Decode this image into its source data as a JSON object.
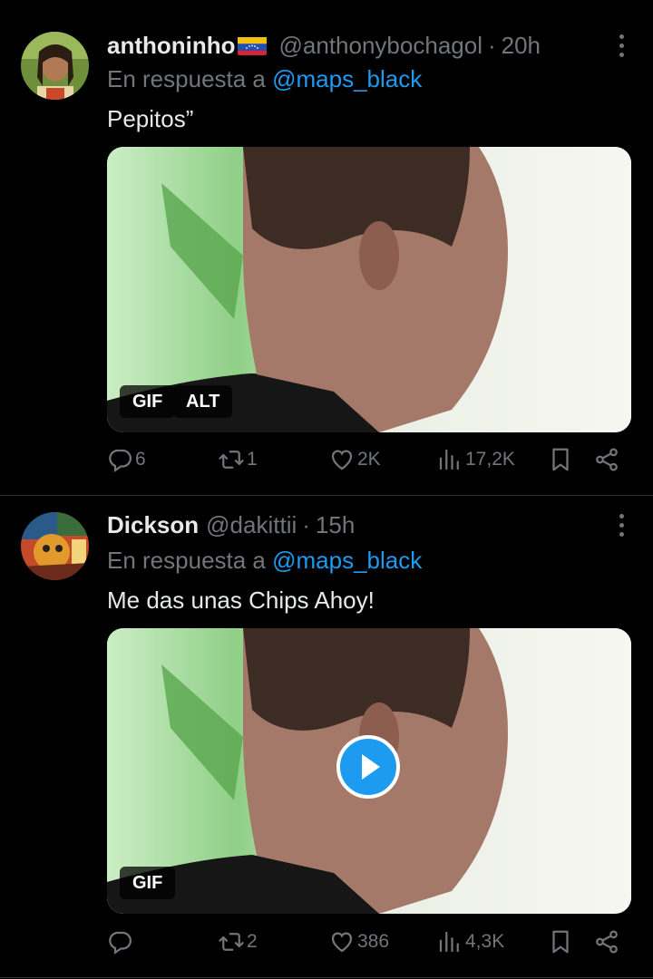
{
  "tweets": [
    {
      "name": "anthoninho",
      "handle": "@anthonybochagol",
      "dot": "·",
      "time": "20h",
      "reply_prefix": "En respuesta a",
      "reply_to": "@maps_black",
      "text": "Pepitos”",
      "media_badges": [
        "GIF",
        "ALT"
      ],
      "stats": {
        "replies": "6",
        "retweets": "1",
        "likes": "2K",
        "views": "17,2K"
      }
    },
    {
      "name": "Dickson",
      "handle": "@dakittii",
      "dot": "·",
      "time": "15h",
      "reply_prefix": "En respuesta a",
      "reply_to": "@maps_black",
      "text": "Me das unas Chips Ahoy!",
      "media_badges": [
        "GIF"
      ],
      "stats": {
        "replies": "",
        "retweets": "2",
        "likes": "386",
        "views": "4,3K"
      }
    }
  ],
  "icons": {
    "more": "more-vertical-icon",
    "reply": "comment-icon",
    "retweet": "retweet-icon",
    "like": "heart-icon",
    "views": "views-bars-icon",
    "bookmark": "bookmark-icon",
    "share": "share-icon",
    "play": "play-icon",
    "flag": "venezuela-flag-icon"
  },
  "colors": {
    "background": "#000000",
    "text": "#e7e9ea",
    "muted": "#71767b",
    "link": "#1d9bf0",
    "divider": "#2f3336"
  }
}
